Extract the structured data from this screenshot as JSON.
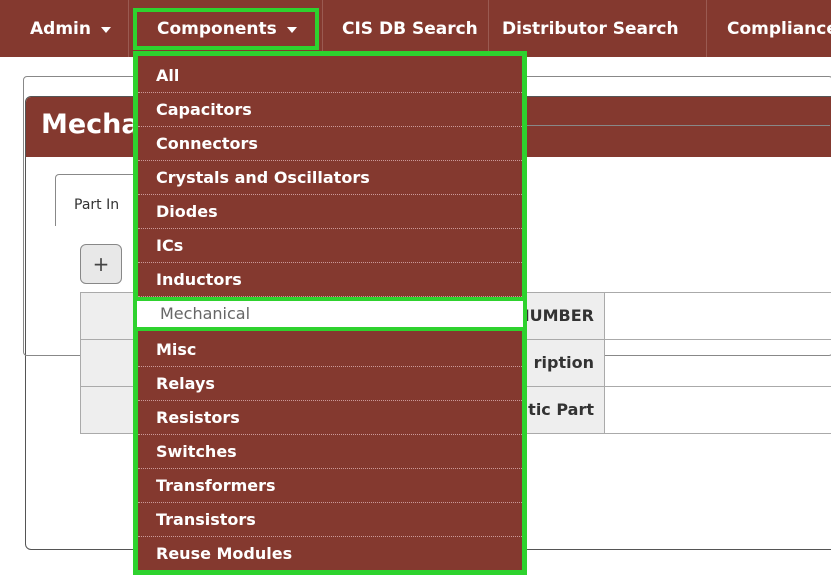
{
  "navbar": {
    "items": [
      {
        "label": "Admin"
      },
      {
        "label": "Components"
      },
      {
        "label": "CIS DB Search"
      },
      {
        "label": "Distributor Search"
      },
      {
        "label": "Compliance"
      }
    ]
  },
  "page": {
    "title": "Mecha",
    "tab_label": "Part In",
    "add_button": "+",
    "fields": [
      "IUMBER",
      "ription",
      "tic Part"
    ]
  },
  "components_menu": {
    "items": [
      "All",
      "Capacitors",
      "Connectors",
      "Crystals and Oscillators",
      "Diodes",
      "ICs",
      "Inductors",
      "Mechanical",
      "Misc",
      "Relays",
      "Resistors",
      "Switches",
      "Transformers",
      "Transistors",
      "Reuse Modules"
    ],
    "active": "Mechanical"
  },
  "colors": {
    "brand": "#84392f",
    "highlight": "#2ed22e"
  }
}
